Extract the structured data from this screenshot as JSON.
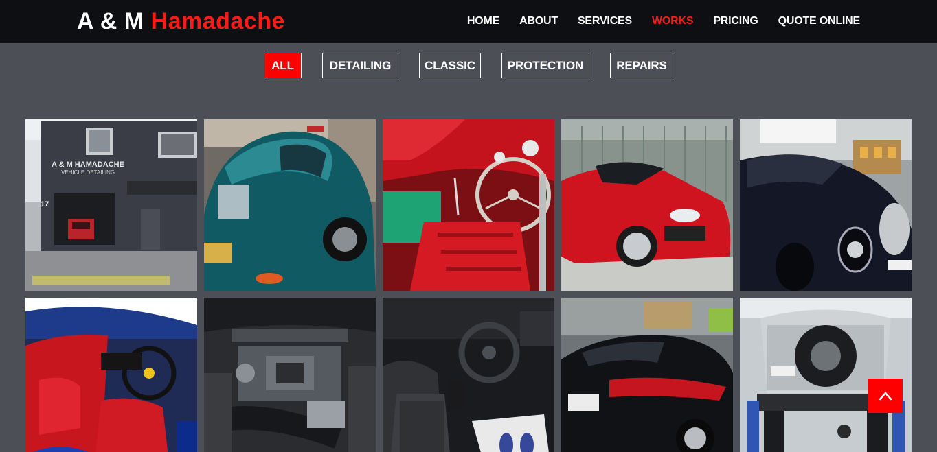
{
  "brand": {
    "part1": "A & M ",
    "part2": "Hamadache"
  },
  "nav": {
    "items": [
      {
        "label": "HOME"
      },
      {
        "label": "ABOUT"
      },
      {
        "label": "SERVICES"
      },
      {
        "label": "WORKS",
        "active": true
      },
      {
        "label": "PRICING"
      },
      {
        "label": "QUOTE ONLINE"
      }
    ]
  },
  "filters": [
    {
      "label": "ALL",
      "active": true
    },
    {
      "label": "DETAILING"
    },
    {
      "label": "CLASSIC"
    },
    {
      "label": "PROTECTION"
    },
    {
      "label": "REPAIRS"
    }
  ],
  "gallery": {
    "items": [
      {
        "icon": "workshop-storefront-photo",
        "sign1": "A & M HAMADACHE",
        "sign2": "VEHICLE DETAILING",
        "number": "17"
      },
      {
        "icon": "teal-porsche-356-photo"
      },
      {
        "icon": "red-corvette-interior-photo"
      },
      {
        "icon": "red-mercedes-sl-photo"
      },
      {
        "icon": "black-morgan-roadster-photo"
      },
      {
        "icon": "ferrari-red-interior-photo"
      },
      {
        "icon": "engine-bay-photo"
      },
      {
        "icon": "black-car-interior-photo"
      },
      {
        "icon": "black-porsche-panamera-photo"
      },
      {
        "icon": "silver-toyota-prado-lift-photo"
      }
    ]
  },
  "colors": {
    "accent": "#ff0000",
    "header_bg": "#0d0f12",
    "page_bg": "#4d4f57"
  },
  "back_to_top": {
    "icon": "chevron-up-icon"
  }
}
